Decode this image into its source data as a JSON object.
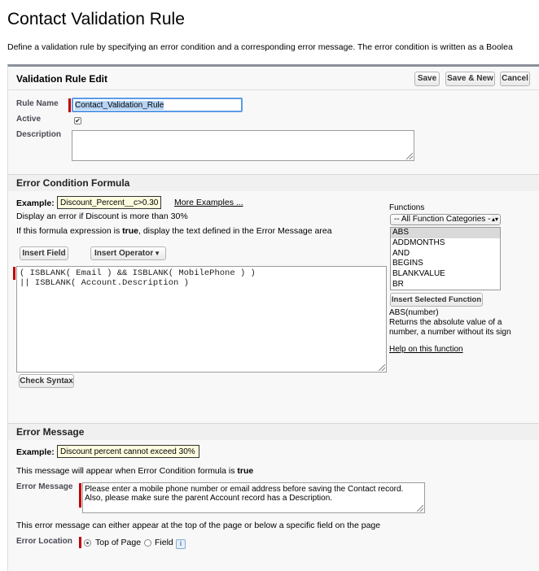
{
  "page": {
    "title": "Contact Validation Rule",
    "description": "Define a validation rule by specifying an error condition and a corresponding error message. The error condition is written as a Boolea"
  },
  "panel": {
    "title": "Validation Rule Edit",
    "buttons": {
      "save": "Save",
      "save_new": "Save & New",
      "cancel": "Cancel"
    }
  },
  "fields": {
    "rule_name_label": "Rule Name",
    "rule_name_value": "Contact_Validation_Rule",
    "active_label": "Active",
    "active_checked": true,
    "description_label": "Description",
    "description_value": ""
  },
  "condition": {
    "section_title": "Error Condition Formula",
    "example_label": "Example:",
    "example_value": "Discount_Percent__c>0.30",
    "more_examples": "More Examples ...",
    "hint1": "Display an error if Discount is more than 30%",
    "hint2_pre": "If this formula expression is ",
    "hint2_bold": "true",
    "hint2_post": ", display the text defined in the Error Message area",
    "insert_field": "Insert Field",
    "insert_operator": "Insert Operator",
    "formula_line1": "( ISBLANK( Email ) && ISBLANK( MobilePhone ) )",
    "formula_line2": "|| ISBLANK( Account.Description )",
    "check_syntax": "Check Syntax"
  },
  "functions": {
    "label": "Functions",
    "category_selected": "-- All Function Categories --",
    "items": [
      "ABS",
      "ADDMONTHS",
      "AND",
      "BEGINS",
      "BLANKVALUE",
      "BR"
    ],
    "selected_index": 0,
    "insert_button": "Insert Selected Function",
    "signature": "ABS(number)",
    "desc_line1": "Returns the absolute value of a",
    "desc_line2": "number, a number without its sign",
    "help_link": "Help on this function"
  },
  "error_message": {
    "section_title": "Error Message",
    "example_label": "Example:",
    "example_value": "Discount percent cannot exceed 30%",
    "hint_pre": "This message will appear when Error Condition formula is ",
    "hint_bold": "true",
    "field_label": "Error Message",
    "line1": "Please enter a mobile phone number or email address before saving the Contact record.",
    "line2": "Also, please make sure the parent Account record has a Description.",
    "location_hint": "This error message can either appear at the top of the page or below a specific field on the page",
    "location_label": "Error Location",
    "option_top": "Top of Page",
    "option_field": "Field",
    "selected_option": "Top of Page",
    "info_icon_glyph": "i"
  }
}
